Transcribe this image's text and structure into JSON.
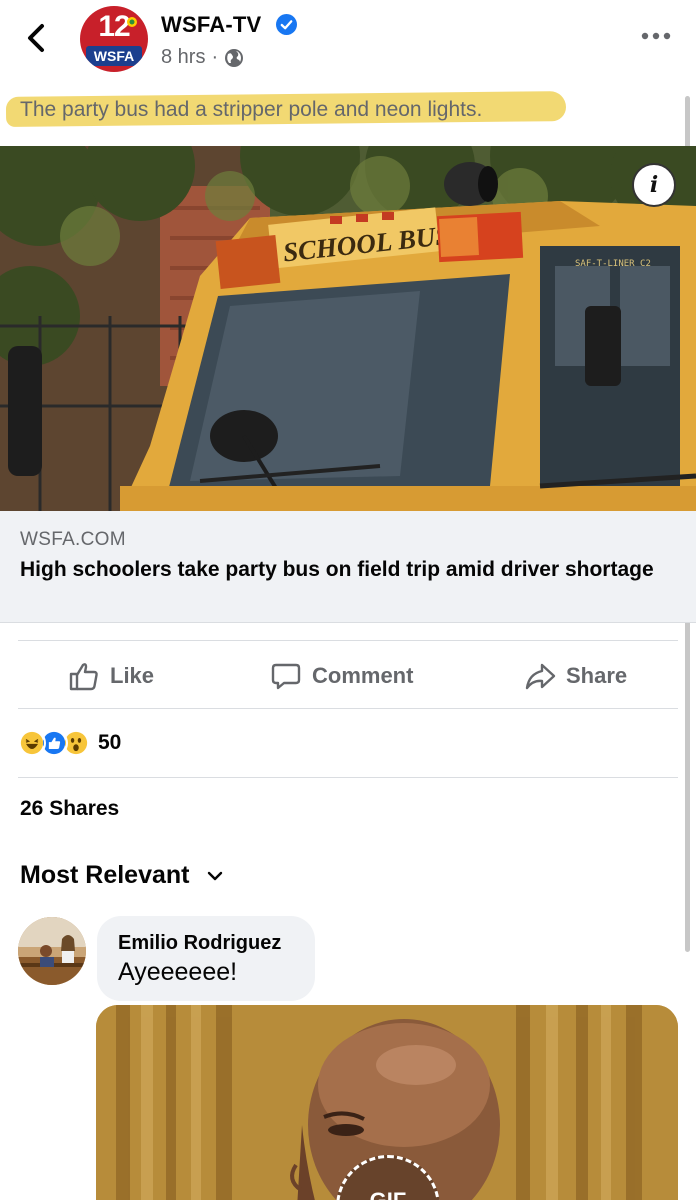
{
  "header": {
    "logo_number": "12",
    "logo_text": "WSFA",
    "page_name": "WSFA-TV",
    "verified": true,
    "time": "8 hrs",
    "separator": "·",
    "privacy_icon": "globe-icon"
  },
  "post": {
    "text": "The party bus had a stripper pole and neon lights.",
    "highlight_color": "#f1d564"
  },
  "photo": {
    "bus_sign": "SCHOOL BUS",
    "bus_model": "SAF-T-LINER C2",
    "info_label": "i"
  },
  "link": {
    "domain": "WSFA.COM",
    "title": "High schoolers take party bus on field trip amid driver shortage"
  },
  "actions": {
    "like": "Like",
    "comment": "Comment",
    "share": "Share"
  },
  "reactions": {
    "types": [
      "haha",
      "like",
      "wow"
    ],
    "count": "50"
  },
  "shares": "26 Shares",
  "sort": "Most Relevant",
  "comments": [
    {
      "author": "Emilio Rodriguez",
      "text": "Ayeeeeee!"
    }
  ],
  "gif": {
    "label": "GIF"
  },
  "colors": {
    "brand_red": "#c8202a",
    "brand_blue": "#1c3f8e",
    "facebook_blue": "#1877f2",
    "secondary_text": "#65676b"
  }
}
